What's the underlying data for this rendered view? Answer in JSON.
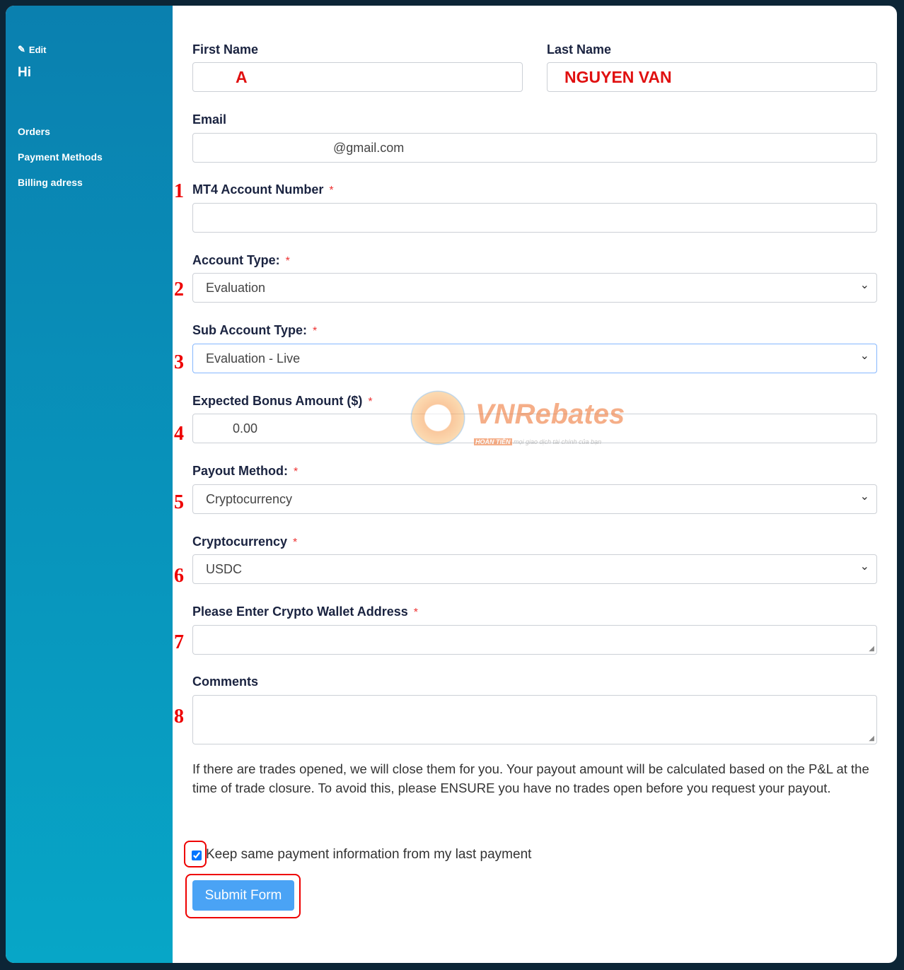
{
  "sidebar": {
    "edit_label": "Edit",
    "greeting": "Hi",
    "items": [
      {
        "label": "Orders"
      },
      {
        "label": "Payment Methods"
      },
      {
        "label": "Billing adress"
      }
    ]
  },
  "form": {
    "first_name": {
      "label": "First Name",
      "value": "A"
    },
    "last_name": {
      "label": "Last Name",
      "value": "NGUYEN VAN"
    },
    "email": {
      "label": "Email",
      "value": "@gmail.com"
    },
    "mt4": {
      "label": "MT4 Account Number",
      "required": "*",
      "value": ""
    },
    "account_type": {
      "label": "Account Type:",
      "required": "*",
      "value": "Evaluation"
    },
    "sub_account_type": {
      "label": "Sub Account Type:",
      "required": "*",
      "value": "Evaluation - Live"
    },
    "bonus": {
      "label": "Expected Bonus Amount ($)",
      "required": "*",
      "value": "0.00"
    },
    "payout_method": {
      "label": "Payout Method:",
      "required": "*",
      "value": "Cryptocurrency"
    },
    "crypto": {
      "label": "Cryptocurrency",
      "required": "*",
      "value": "USDC"
    },
    "wallet": {
      "label": "Please Enter Crypto Wallet Address",
      "required": "*",
      "value": ""
    },
    "comments": {
      "label": "Comments",
      "value": ""
    },
    "note": "If there are trades opened, we will close them for you. Your payout amount will be calculated based on the P&L at the time of trade closure. To avoid this, please ENSURE you have no trades open before you request your payout.",
    "keep_same": {
      "label": "Keep same payment information from my last payment",
      "checked": true
    },
    "submit_label": "Submit Form"
  },
  "annotations": [
    "1",
    "2",
    "3",
    "4",
    "5",
    "6",
    "7",
    "8"
  ],
  "watermark": {
    "brand": "VNRebates",
    "tag": "HOÀN TIỀN",
    "slogan": "mọi giao dịch tài chính của bạn"
  },
  "colors": {
    "sidebar": "#0a80af",
    "accent": "#4aa3f5",
    "annotation": "#e00000"
  }
}
